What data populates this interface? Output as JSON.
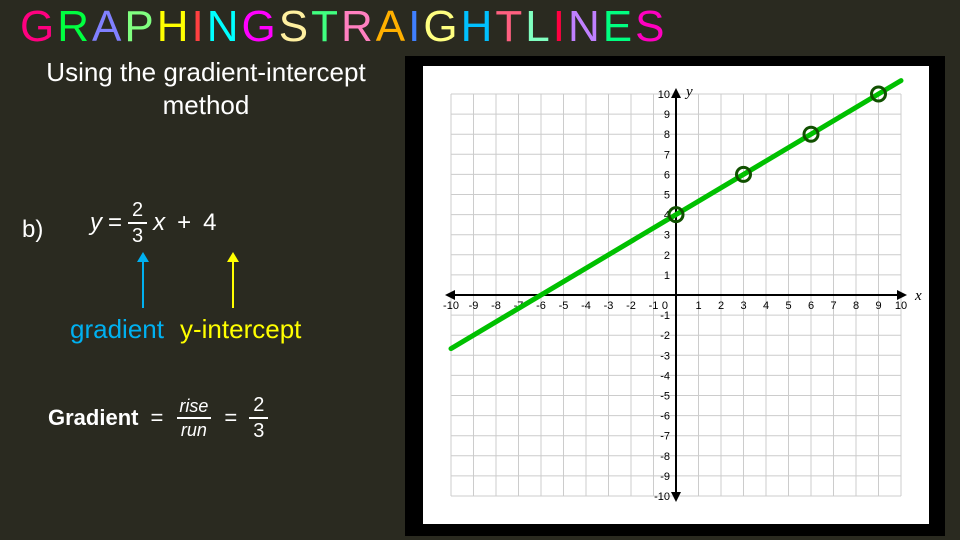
{
  "title_chars": [
    {
      "c": "G",
      "color": "#ff0080"
    },
    {
      "c": "R",
      "color": "#00ff40"
    },
    {
      "c": "A",
      "color": "#8080ff"
    },
    {
      "c": "P",
      "color": "#80ff80"
    },
    {
      "c": "H",
      "color": "#ffff00"
    },
    {
      "c": "I",
      "color": "#ff4040"
    },
    {
      "c": "N",
      "color": "#00ffff"
    },
    {
      "c": "G",
      "color": "#ff00ff"
    },
    {
      "c": " ",
      "color": "#fff"
    },
    {
      "c": "S",
      "color": "#fff0a0"
    },
    {
      "c": "T",
      "color": "#40ff80"
    },
    {
      "c": "R",
      "color": "#ff80c0"
    },
    {
      "c": "A",
      "color": "#ffb000"
    },
    {
      "c": "I",
      "color": "#4080ff"
    },
    {
      "c": "G",
      "color": "#ffff80"
    },
    {
      "c": "H",
      "color": "#00c0ff"
    },
    {
      "c": "T",
      "color": "#ff6080"
    },
    {
      "c": " ",
      "color": "#fff"
    },
    {
      "c": "L",
      "color": "#80ffc0"
    },
    {
      "c": "I",
      "color": "#ff0040"
    },
    {
      "c": "N",
      "color": "#c080ff"
    },
    {
      "c": "E",
      "color": "#00ff80"
    },
    {
      "c": "S",
      "color": "#ff00c0"
    }
  ],
  "subtitle": "Using the gradient-intercept method",
  "item_letter": "b)",
  "equation": {
    "y": "y",
    "eq": "=",
    "num": "2",
    "den": "3",
    "x": "x",
    "plus": "+",
    "c": "4"
  },
  "labels": {
    "gradient": "gradient",
    "yintercept": "y-intercept"
  },
  "formula": {
    "word": "Gradient",
    "eq1": "=",
    "rise": "rise",
    "run": "run",
    "eq2": "=",
    "num": "2",
    "den": "3"
  },
  "chart_data": {
    "type": "line",
    "title": "",
    "xlabel": "x",
    "ylabel": "y",
    "xlim": [
      -10,
      10
    ],
    "ylim": [
      -10,
      10
    ],
    "xticks": [
      -10,
      -9,
      -8,
      -7,
      -6,
      -5,
      -4,
      -3,
      -2,
      -1,
      0,
      1,
      2,
      3,
      4,
      5,
      6,
      7,
      8,
      9,
      10
    ],
    "yticks": [
      -10,
      -9,
      -8,
      -7,
      -6,
      -5,
      -4,
      -3,
      -2,
      -1,
      0,
      1,
      2,
      3,
      4,
      5,
      6,
      7,
      8,
      9,
      10
    ],
    "grid": true,
    "series": [
      {
        "name": "y = (2/3)x + 4",
        "color": "#00c000",
        "x": [
          -10,
          10
        ],
        "y": [
          -2.667,
          10.667
        ]
      }
    ],
    "points": [
      {
        "x": 0,
        "y": 4
      },
      {
        "x": 3,
        "y": 6
      },
      {
        "x": 6,
        "y": 8
      },
      {
        "x": 9,
        "y": 10
      }
    ]
  }
}
